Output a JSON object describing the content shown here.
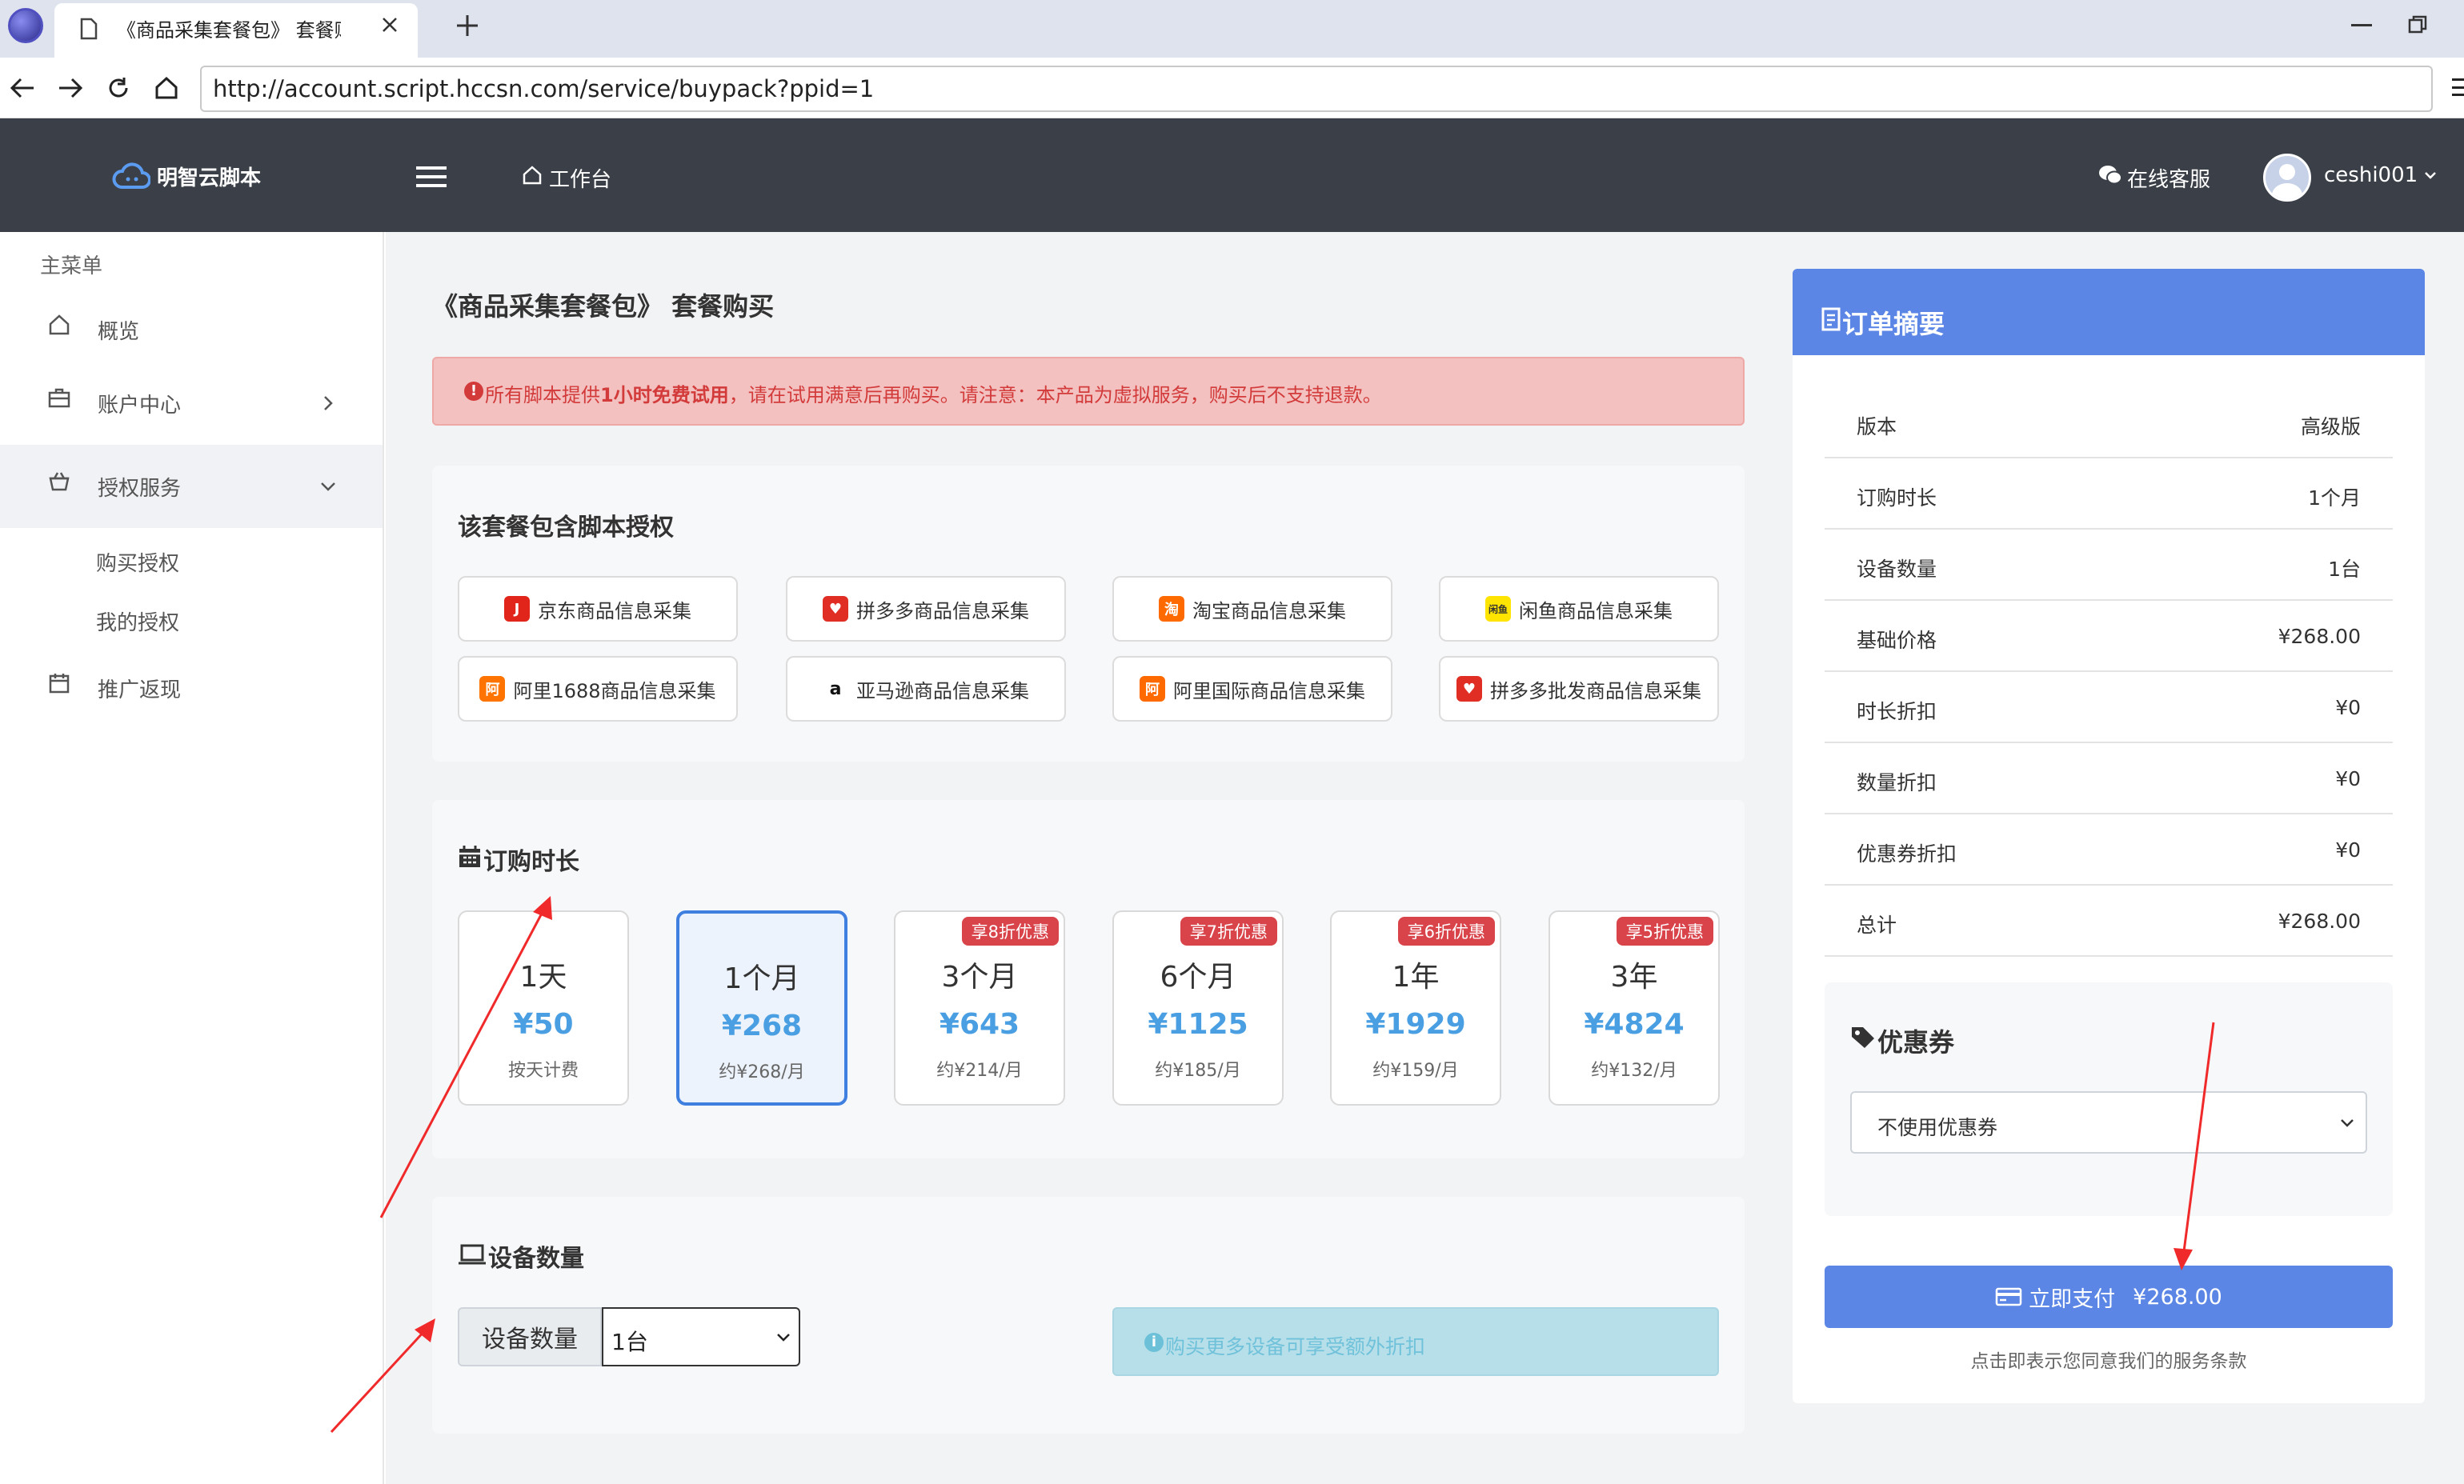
{
  "browser": {
    "tab_title": "《商品采集套餐包》 套餐购:",
    "url": "http://account.script.hccsn.com/service/buypack?ppid=1",
    "new_tab": "+"
  },
  "header": {
    "brand": "明智云脚本",
    "workbench": "工作台",
    "customer_service": "在线客服",
    "username": "ceshi001"
  },
  "sidebar": {
    "menu_title": "主菜单",
    "items": [
      {
        "label": "概览"
      },
      {
        "label": "账户中心"
      },
      {
        "label": "授权服务"
      },
      {
        "label": "购买授权"
      },
      {
        "label": "我的授权"
      },
      {
        "label": "推广返现"
      }
    ]
  },
  "main": {
    "page_title": "《商品采集套餐包》 套餐购买",
    "alert": {
      "prefix": "所有脚本提供",
      "highlight": "1小时免费试用",
      "suffix": "，请在试用满意后再购买。请注意：本产品为虚拟服务，购买后不支持退款。"
    },
    "scripts_title": "该套餐包含脚本授权",
    "scripts": [
      {
        "label": "京东商品信息采集",
        "icon": "jd-icon",
        "color": "#e1251b"
      },
      {
        "label": "拼多多商品信息采集",
        "icon": "pinduoduo-icon",
        "color": "#e02e24"
      },
      {
        "label": "淘宝商品信息采集",
        "icon": "taobao-icon",
        "color": "#ff6a00"
      },
      {
        "label": "闲鱼商品信息采集",
        "icon": "xianyu-icon",
        "color": "#ffe400"
      },
      {
        "label": "阿里1688商品信息采集",
        "icon": "alibaba1688-icon",
        "color": "#ff7300"
      },
      {
        "label": "亚马逊商品信息采集",
        "icon": "amazon-icon",
        "color": "#ffffff"
      },
      {
        "label": "阿里国际商品信息采集",
        "icon": "alibaba-intl-icon",
        "color": "#ff6a00"
      },
      {
        "label": "拼多多批发商品信息采集",
        "icon": "pinduoduo-wholesale-icon",
        "color": "#e02e24"
      }
    ],
    "duration_title": "订购时长",
    "durations": [
      {
        "label": "1天",
        "price": "¥50",
        "sub": "按天计费",
        "badge": ""
      },
      {
        "label": "1个月",
        "price": "¥268",
        "sub": "约¥268/月",
        "badge": "",
        "selected": true
      },
      {
        "label": "3个月",
        "price": "¥643",
        "sub": "约¥214/月",
        "badge": "享8折优惠"
      },
      {
        "label": "6个月",
        "price": "¥1125",
        "sub": "约¥185/月",
        "badge": "享7折优惠"
      },
      {
        "label": "1年",
        "price": "¥1929",
        "sub": "约¥159/月",
        "badge": "享6折优惠"
      },
      {
        "label": "3年",
        "price": "¥4824",
        "sub": "约¥132/月",
        "badge": "享5折优惠"
      }
    ],
    "device_title": "设备数量",
    "device_label": "设备数量",
    "device_value": "1台",
    "device_tip": "购买更多设备可享受额外折扣"
  },
  "summary": {
    "title": "订单摘要",
    "rows": [
      {
        "key": "版本",
        "value": "高级版"
      },
      {
        "key": "订购时长",
        "value": "1个月"
      },
      {
        "key": "设备数量",
        "value": "1台"
      },
      {
        "key": "基础价格",
        "value": "¥268.00"
      },
      {
        "key": "时长折扣",
        "value": "¥0"
      },
      {
        "key": "数量折扣",
        "value": "¥0"
      },
      {
        "key": "优惠券折扣",
        "value": "¥0"
      },
      {
        "key": "总计",
        "value": "¥268.00"
      }
    ],
    "coupon_title": "优惠券",
    "coupon_value": "不使用优惠券",
    "pay_label": "立即支付",
    "pay_amount": "¥268.00",
    "terms": "点击即表示您同意我们的服务条款"
  },
  "colors": {
    "accent": "#5b86e5",
    "header_bg": "#3b4048",
    "price_blue": "#4a9fe3",
    "badge_red": "#d9444b",
    "alert_bg": "#f2c1c0"
  }
}
